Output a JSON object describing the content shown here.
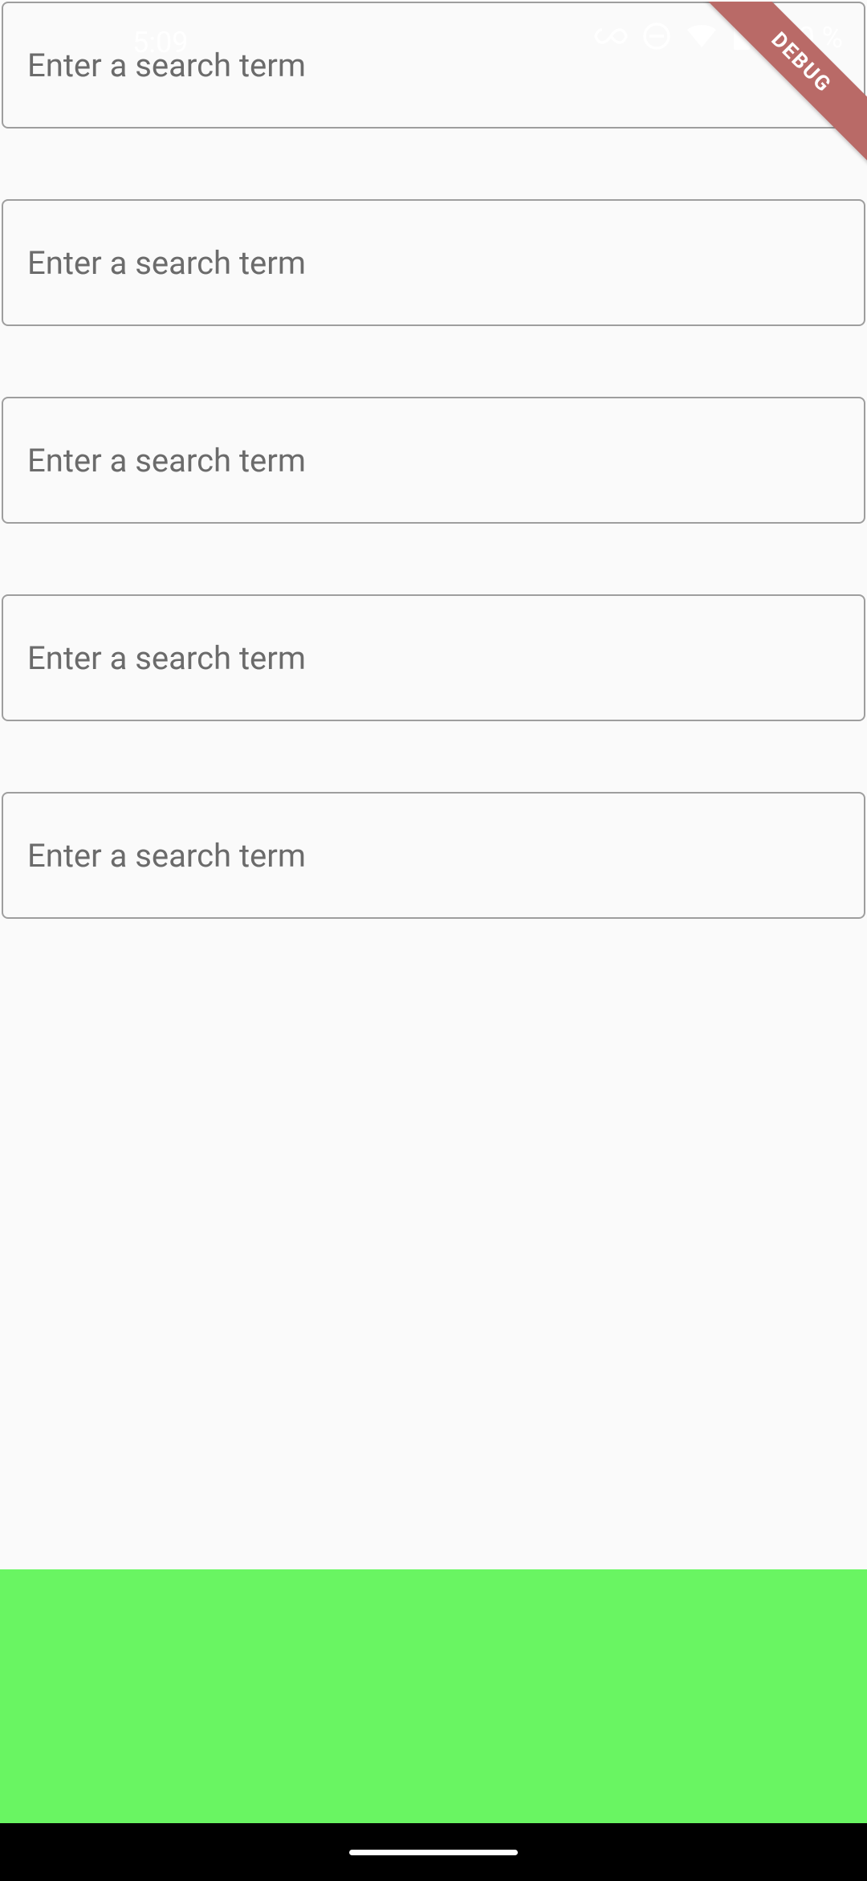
{
  "status_bar": {
    "time": "5:09",
    "battery_pct": "100 %",
    "icons": {
      "link": "link-icon",
      "dnd": "do-not-disturb-icon",
      "wifi": "wifi-icon",
      "battery": "battery-icon"
    }
  },
  "debug": {
    "label": "DEBUG"
  },
  "inputs": [
    {
      "placeholder": "Enter a search term"
    },
    {
      "placeholder": "Enter a search term"
    },
    {
      "placeholder": "Enter a search term"
    },
    {
      "placeholder": "Enter a search term"
    },
    {
      "placeholder": "Enter a search term"
    }
  ],
  "colors": {
    "panel_green": "#69f562",
    "debug_ribbon": "#b96a67",
    "bg": "#fafafa",
    "border": "#9e9e9e"
  }
}
